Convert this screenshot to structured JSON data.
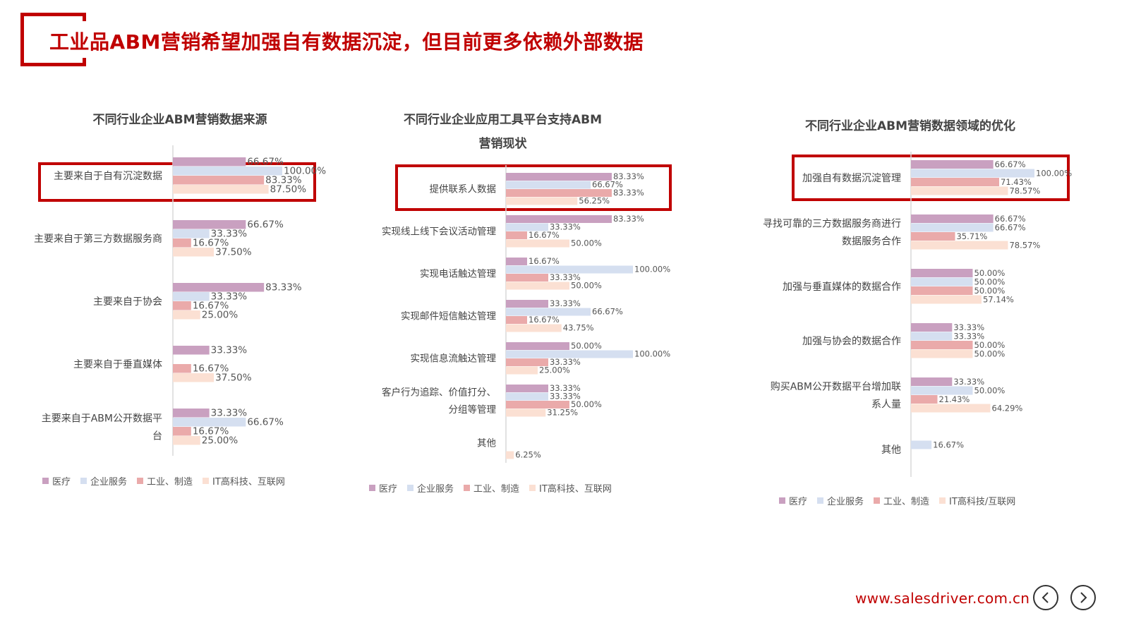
{
  "title": "工业品ABM营销希望加强自有数据沉淀，但目前更多依赖外部数据",
  "footer": {
    "url": "www.salesdriver.com.cn",
    "prev_icon": "chevron-left-icon",
    "next_icon": "chevron-right-icon"
  },
  "colors": {
    "accent": "#c00000",
    "医疗": "#c9a0c0",
    "企业服务": "#d5dff0",
    "工业、制造": "#eaaaaa",
    "IT": "#fbe0d3",
    "highlight": "#c00000"
  },
  "chart_data": [
    {
      "type": "bar",
      "orientation": "horizontal",
      "title": "不同行业企业ABM营销数据来源",
      "categories": [
        "主要来自于自有沉淀数据",
        "主要来自于第三方数据服务商",
        "主要来自于协会",
        "主要来自于垂直媒体",
        "主要来自于ABM公开数据平台"
      ],
      "series": [
        {
          "name": "医疗",
          "values": [
            66.67,
            66.67,
            83.33,
            33.33,
            33.33
          ]
        },
        {
          "name": "企业服务",
          "values": [
            100.0,
            33.33,
            33.33,
            null,
            66.67
          ]
        },
        {
          "name": "工业、制造",
          "values": [
            83.33,
            16.67,
            16.67,
            16.67,
            16.67
          ]
        },
        {
          "name": "IT高科技、互联网",
          "values": [
            87.5,
            37.5,
            25.0,
            37.5,
            25.0
          ]
        }
      ],
      "labels": [
        [
          "66.67%",
          "100.00%",
          "83.33%",
          "87.50%"
        ],
        [
          "66.67%",
          "33.33%",
          "16.67%",
          "37.50%"
        ],
        [
          "83.33%",
          "33.33%",
          "16.67%",
          "25.00%"
        ],
        [
          "33.33%",
          "",
          "16.67%",
          "37.50%"
        ],
        [
          "33.33%",
          "66.67%",
          "16.67%",
          "25.00%"
        ]
      ],
      "highlight_index": 0,
      "legend": "bottom"
    },
    {
      "type": "bar",
      "orientation": "horizontal",
      "title": "不同行业企业应用工具平台支持ABM营销现状",
      "categories": [
        "提供联系人数据",
        "实现线上线下会议活动管理",
        "实现电话触达管理",
        "实现邮件短信触达管理",
        "实现信息流触达管理",
        "客户行为追踪、价值打分、分组等管理",
        "其他"
      ],
      "series": [
        {
          "name": "医疗",
          "values": [
            83.33,
            83.33,
            16.67,
            33.33,
            50.0,
            33.33,
            null
          ]
        },
        {
          "name": "企业服务",
          "values": [
            66.67,
            33.33,
            100.0,
            66.67,
            100.0,
            33.33,
            null
          ]
        },
        {
          "name": "工业、制造",
          "values": [
            83.33,
            16.67,
            33.33,
            16.67,
            33.33,
            50.0,
            null
          ]
        },
        {
          "name": "IT高科技、互联网",
          "values": [
            56.25,
            50.0,
            50.0,
            43.75,
            25.0,
            31.25,
            6.25
          ]
        }
      ],
      "labels": [
        [
          "83.33%",
          "66.67%",
          "83.33%",
          "56.25%"
        ],
        [
          "83.33%",
          "33.33%",
          "16.67%",
          "50.00%"
        ],
        [
          "16.67%",
          "100.00%",
          "33.33%",
          "50.00%"
        ],
        [
          "33.33%",
          "66.67%",
          "16.67%",
          "43.75%"
        ],
        [
          "50.00%",
          "100.00%",
          "33.33%",
          "25.00%"
        ],
        [
          "33.33%",
          "33.33%",
          "50.00%",
          "31.25%"
        ],
        [
          "",
          "",
          "",
          "6.25%"
        ]
      ],
      "highlight_index": 0,
      "legend": "bottom"
    },
    {
      "type": "bar",
      "orientation": "horizontal",
      "title": "不同行业企业ABM营销数据领域的优化",
      "categories": [
        "加强自有数据沉淀管理",
        "寻找可靠的三方数据服务商进行数据服务合作",
        "加强与垂直媒体的数据合作",
        "加强与协会的数据合作",
        "购买ABM公开数据平台增加联系人量",
        "其他"
      ],
      "series": [
        {
          "name": "医疗",
          "values": [
            66.67,
            66.67,
            50.0,
            33.33,
            33.33,
            null
          ]
        },
        {
          "name": "企业服务",
          "values": [
            100.0,
            66.67,
            50.0,
            33.33,
            50.0,
            16.67
          ]
        },
        {
          "name": "工业、制造",
          "values": [
            71.43,
            35.71,
            50.0,
            50.0,
            21.43,
            null
          ]
        },
        {
          "name": "IT高科技/互联网",
          "values": [
            78.57,
            78.57,
            57.14,
            50.0,
            64.29,
            null
          ]
        }
      ],
      "labels": [
        [
          "66.67%",
          "100.00%",
          "71.43%",
          "78.57%"
        ],
        [
          "66.67%",
          "66.67%",
          "35.71%",
          "78.57%"
        ],
        [
          "50.00%",
          "50.00%",
          "50.00%",
          "57.14%"
        ],
        [
          "33.33%",
          "33.33%",
          "50.00%",
          "50.00%"
        ],
        [
          "33.33%",
          "50.00%",
          "21.43%",
          "64.29%"
        ],
        [
          "",
          "16.67%",
          "",
          ""
        ]
      ],
      "highlight_index": 0,
      "legend": "bottom"
    }
  ]
}
